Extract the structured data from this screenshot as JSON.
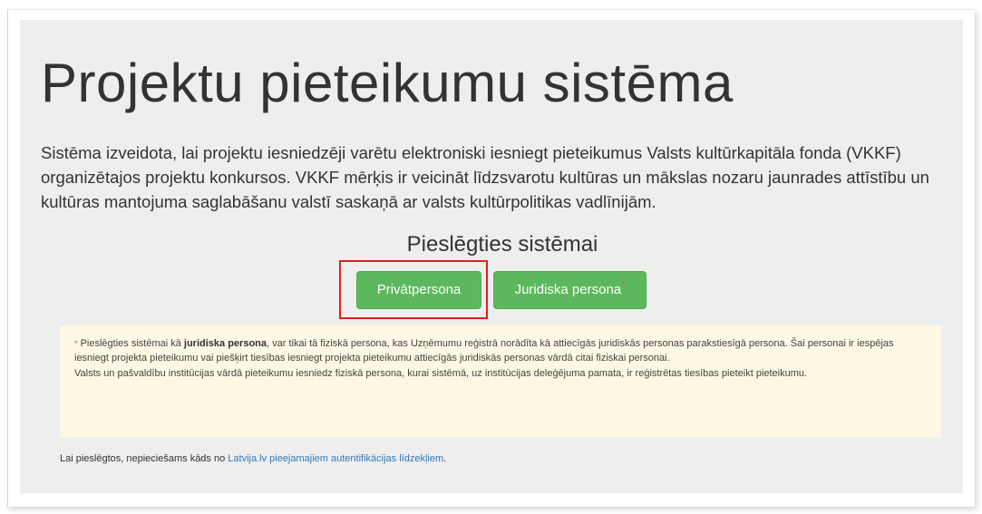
{
  "page": {
    "title": "Projektu pieteikumu sistēma",
    "intro": "Sistēma izveidota, lai projektu iesniedzēji varētu elektroniski iesniegt pieteikumus Valsts kultūrkapitāla fonda (VKKF) organizētajos projektu konkursos. VKKF mērķis ir veicināt līdzsvarotu kultūras un mākslas nozaru jaunrades attīstību un kultūras mantojuma saglabāšanu valstī saskaņā ar valsts kultūrpolitikas vadlīnijām."
  },
  "login": {
    "heading": "Pieslēgties sistēmai",
    "private_button": "Privātpersona",
    "legal_button": "Juridiska persona",
    "legal_marker": "*"
  },
  "notice": {
    "marker": "*",
    "part1": " Pieslēgties sistēmai kā ",
    "bold": "juridiska persona",
    "part2": ", var tikai tā fiziskā persona, kas Uzņēmumu reģistrā norādīta kā attiecīgās juridiskās personas parakstiesīgā persona. Šai personai ir iespējas iesniegt projekta pieteikumu vai piešķirt tiesības iesniegt projekta pieteikumu attiecīgās juridiskās personas vārdā citai fiziskai personai.",
    "paragraph2": "Valsts un pašvaldību institūcijas vārdā pieteikumu iesniedz fiziskā persona, kurai sistēmā, uz institūcijas deleģējuma pamata, ir reģistrētas tiesības pieteikt pieteikumu."
  },
  "footer": {
    "text": "Lai pieslēgtos, nepieciešams kāds no ",
    "link": "Latvija.lv pieejamajiem autentifikācijas līdzekļiem",
    "suffix": "."
  },
  "colors": {
    "button_green": "#5cb85c",
    "highlight_red": "#e0201c",
    "notice_bg": "#fcf8e3",
    "link_blue": "#337ab7"
  }
}
